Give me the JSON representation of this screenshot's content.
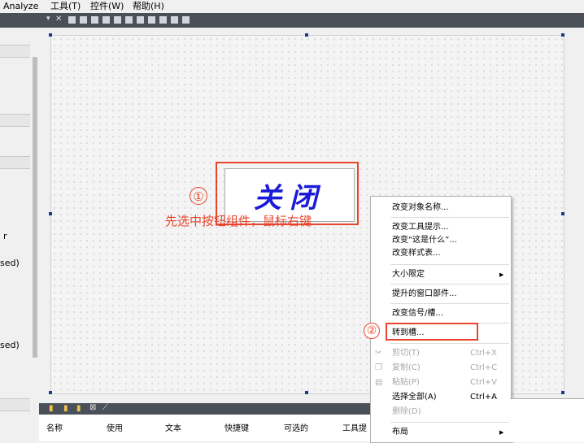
{
  "menubar": {
    "items": [
      {
        "label": "Analyze"
      },
      {
        "label": "工具(T)"
      },
      {
        "label": "控件(W)"
      },
      {
        "label": "帮助(H)"
      }
    ]
  },
  "left_panel": {
    "frag1": "r",
    "frag2": "sed)",
    "frag3": "sed)"
  },
  "form": {
    "button_text": "关闭",
    "annotation_1_num": "①",
    "annotation_1_text": "先选中按钮组件，鼠标右键",
    "annotation_2_num": "②"
  },
  "context_menu": {
    "items": [
      {
        "label": "改变对象名称..."
      },
      {
        "label": "改变工具提示..."
      },
      {
        "label": "改变“这是什么”..."
      },
      {
        "label": "改变样式表..."
      },
      {
        "label": "大小限定"
      },
      {
        "label": "提升的窗口部件..."
      },
      {
        "label": "改变信号/槽..."
      },
      {
        "label": "转到槽..."
      },
      {
        "label": "剪切(T)",
        "shortcut": "Ctrl+X"
      },
      {
        "label": "复制(C)",
        "shortcut": "Ctrl+C"
      },
      {
        "label": "粘贴(P)",
        "shortcut": "Ctrl+V"
      },
      {
        "label": "选择全部(A)",
        "shortcut": "Ctrl+A"
      },
      {
        "label": "删除(D)"
      },
      {
        "label": "布局"
      }
    ]
  },
  "bottom_panel": {
    "columns": [
      "名称",
      "使用",
      "文本",
      "快捷键",
      "可选的",
      "工具提"
    ]
  },
  "colors": {
    "accent_red": "#e8452c",
    "button_text_blue": "#1a1ad8",
    "toolbar_dark": "#4a5058"
  }
}
